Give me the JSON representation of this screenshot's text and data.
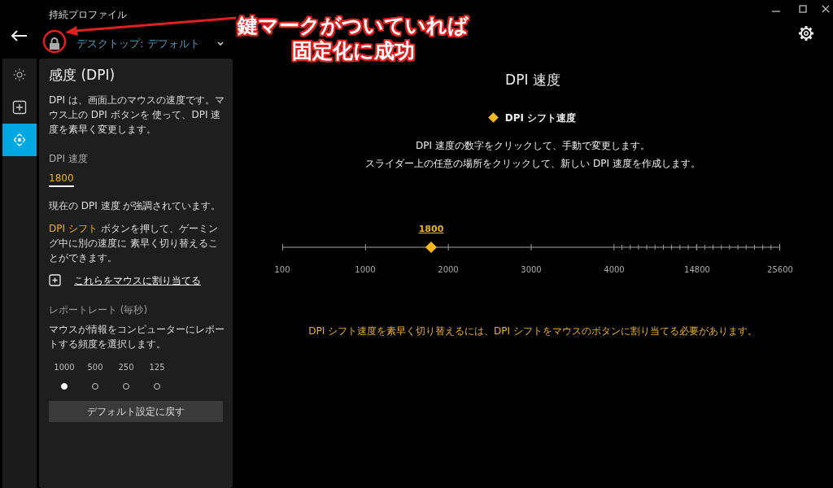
{
  "header": {
    "profile_label": "持続プロファイル",
    "profile_name": "デスクトップ: デフォルト",
    "locked": true
  },
  "nav": [
    {
      "kind": "lighting",
      "selected": false
    },
    {
      "kind": "assignments",
      "selected": false
    },
    {
      "kind": "sensitivity",
      "selected": true
    }
  ],
  "panel": {
    "title": "感度 (DPI)",
    "description": "DPI は、画面上のマウスの速度です。マウス上の DPI ボタンを 使って、DPI 速度を素早く変更します。",
    "speed_label": "DPI 速度",
    "speed_value": "1800",
    "current_note": "現在の DPI 速度 が強調されています。",
    "shift_note": {
      "highlight": "DPI シフト",
      "text": " ボタンを押して、ゲーミング中に別の速度に 素早く切り替えることができます。"
    },
    "assign_link": "これらをマウスに割り当てる",
    "report_label": "レポートレート (毎秒)",
    "report_description": "マウスが情報をコンピューターにレポートする頻度を選択します。",
    "report_rates": [
      {
        "label": "1000",
        "selected": true
      },
      {
        "label": "500",
        "selected": false
      },
      {
        "label": "250",
        "selected": false
      },
      {
        "label": "125",
        "selected": false
      }
    ],
    "reset_button": "デフォルト設定に戻す"
  },
  "main": {
    "title": "DPI 速度",
    "legend": "DPI シフト速度",
    "instructions": [
      "DPI 速度の数字をクリックして、手動で変更します。",
      "スライダー上の任意の場所をクリックして、新しい DPI 速度を作成します。"
    ],
    "slider": {
      "value": "1800",
      "level": 0.299,
      "tick_labels": [
        "100",
        "1000",
        "2000",
        "3000",
        "4000",
        "14800",
        "25600"
      ]
    },
    "notice": "DPI シフト速度を素早く切り替えるには、DPI シフトをマウスのボタンに割り当てる必要があります。"
  },
  "annotation": {
    "lines": [
      "鍵マークがついていれば",
      "固定化に成功"
    ]
  }
}
